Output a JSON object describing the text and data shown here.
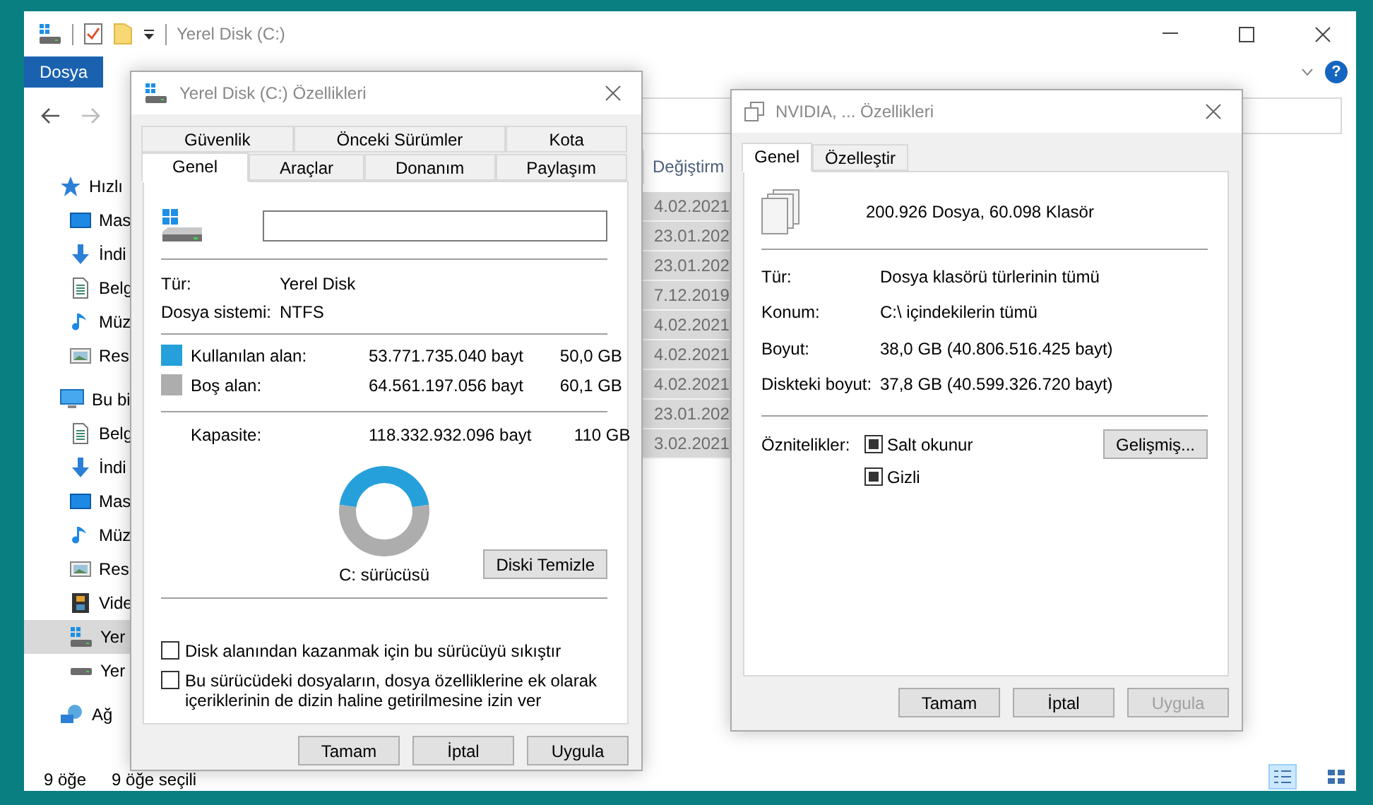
{
  "explorer": {
    "title": "Yerel Disk (C:)",
    "file_tab": "Dosya",
    "help": "?",
    "sidebar": [
      {
        "label": "Hızlı",
        "kind": "quick",
        "selected": false,
        "children": [
          {
            "label": "Mas",
            "kind": "desktop",
            "selected": false
          },
          {
            "label": "İndi",
            "kind": "download",
            "selected": false
          },
          {
            "label": "Belg",
            "kind": "documents",
            "selected": false
          },
          {
            "label": "Müz",
            "kind": "music",
            "selected": false
          },
          {
            "label": "Res",
            "kind": "pictures",
            "selected": false
          }
        ]
      },
      {
        "label": "Bu bi",
        "kind": "pc",
        "selected": false,
        "children": [
          {
            "label": "Belg",
            "kind": "documents",
            "selected": false
          },
          {
            "label": "İndi",
            "kind": "download",
            "selected": false
          },
          {
            "label": "Mas",
            "kind": "desktop",
            "selected": false
          },
          {
            "label": "Müz",
            "kind": "music",
            "selected": false
          },
          {
            "label": "Res",
            "kind": "pictures",
            "selected": false
          },
          {
            "label": "Vide",
            "kind": "videos",
            "selected": false
          },
          {
            "label": "Yer",
            "kind": "system-drive",
            "selected": true
          },
          {
            "label": "Yer",
            "kind": "drive",
            "selected": false
          }
        ]
      },
      {
        "label": "Ağ",
        "kind": "network",
        "selected": false
      }
    ],
    "column_header": "Değiştirm",
    "rows": [
      {
        "modified": "4.02.2021",
        "selected": true
      },
      {
        "modified": "23.01.202",
        "selected": true
      },
      {
        "modified": "23.01.202",
        "selected": true
      },
      {
        "modified": "7.12.2019",
        "selected": true
      },
      {
        "modified": "4.02.2021",
        "selected": true
      },
      {
        "modified": "4.02.2021",
        "selected": true
      },
      {
        "modified": "4.02.2021",
        "selected": true
      },
      {
        "modified": "23.01.202",
        "selected": true
      },
      {
        "modified": "3.02.2021",
        "selected": true
      }
    ],
    "status": {
      "count": "9 öğe",
      "selection": "9 öğe seçili"
    }
  },
  "disk_dialog": {
    "title": "Yerel Disk (C:) Özellikleri",
    "tab_rows": [
      [
        {
          "label": "Güvenlik",
          "selected": false
        },
        {
          "label": "Önceki Sürümler",
          "selected": false
        },
        {
          "label": "Kota",
          "selected": false
        }
      ],
      [
        {
          "label": "Genel",
          "selected": true
        },
        {
          "label": "Araçlar",
          "selected": false
        },
        {
          "label": "Donanım",
          "selected": false
        },
        {
          "label": "Paylaşım",
          "selected": false
        }
      ]
    ],
    "info": [
      {
        "label": "Tür:",
        "value": "Yerel Disk"
      },
      {
        "label": "Dosya sistemi:",
        "value": "NTFS"
      }
    ],
    "space": [
      {
        "label": "Kullanılan alan:",
        "bytes": "53.771.735.040 bayt",
        "size": "50,0 GB",
        "color": "#26a0da"
      },
      {
        "label": "Boş alan:",
        "bytes": "64.561.197.056 bayt",
        "size": "60,1 GB",
        "color": "#adadad"
      }
    ],
    "capacity": {
      "label": "Kapasite:",
      "bytes": "118.332.932.096 bayt",
      "size": "110 GB"
    },
    "chart_data": {
      "type": "donut",
      "values": [
        45.4,
        54.6
      ]
    },
    "drive_label": "C: sürücüsü",
    "cleanup_button": "Diski Temizle",
    "options": [
      {
        "label": "Disk alanından kazanmak için bu sürücüyü sıkıştır",
        "checked": false
      },
      {
        "label": "Bu sürücüdeki dosyaların, dosya özelliklerine ek olarak içeriklerinin de dizin haline getirilmesine izin ver",
        "checked": false
      }
    ],
    "buttons": [
      {
        "label": "Tamam",
        "disabled": false
      },
      {
        "label": "İptal",
        "disabled": false
      },
      {
        "label": "Uygula",
        "disabled": false
      }
    ]
  },
  "folder_dialog": {
    "title": "NVIDIA, ... Özellikleri",
    "tabs": [
      {
        "label": "Genel",
        "selected": true
      },
      {
        "label": "Özelleştir",
        "selected": false
      }
    ],
    "summary": "200.926 Dosya, 60.098 Klasör",
    "info": [
      {
        "label": "Tür:",
        "value": "Dosya klasörü türlerinin tümü"
      },
      {
        "label": "Konum:",
        "value": "C:\\ içindekilerin tümü"
      },
      {
        "label": "Boyut:",
        "value": "38,0 GB (40.806.516.425 bayt)"
      },
      {
        "label": "Diskteki boyut:",
        "value": "37,8 GB (40.599.326.720 bayt)"
      }
    ],
    "attributes_label": "Öznitelikler:",
    "attributes": [
      {
        "label": "Salt okunur",
        "mixed": true
      },
      {
        "label": "Gizli",
        "mixed": true
      }
    ],
    "advanced_button": "Gelişmiş...",
    "buttons": [
      {
        "label": "Tamam",
        "disabled": false
      },
      {
        "label": "İptal",
        "disabled": false
      },
      {
        "label": "Uygula",
        "disabled": true
      }
    ]
  }
}
